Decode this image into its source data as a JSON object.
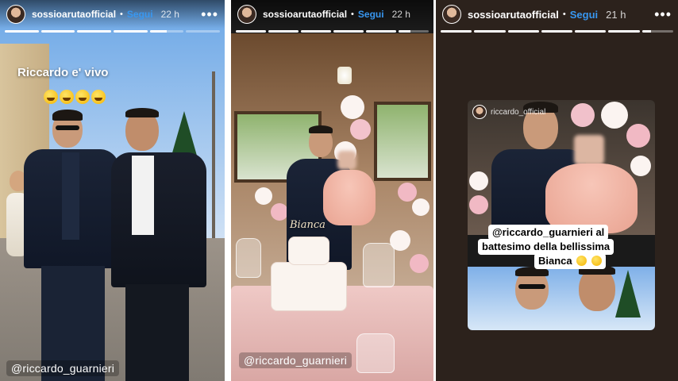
{
  "stories": [
    {
      "username": "sossioarutaofficial",
      "follow_label": "Segui",
      "time": "22 h",
      "more_label": "•••",
      "caption": "Riccardo e' vivo",
      "emoji_count": 4,
      "mention": "@riccardo_guarnieri"
    },
    {
      "username": "sossioarutaofficial",
      "follow_label": "Segui",
      "time": "22 h",
      "more_label": "•••",
      "mention": "@riccardo_guarnieri",
      "cake_text": "Bianca"
    },
    {
      "username": "sossioarutaofficial",
      "follow_label": "Segui",
      "time": "21 h",
      "more_label": "•••",
      "repost_user": "riccardo_official",
      "caption_line1": "@riccardo_guarnieri al",
      "caption_line2": "battesimo della bellissima",
      "caption_line3": "Bianca"
    }
  ],
  "colors": {
    "follow": "#3897f0",
    "caption_bg": "#ffffff"
  },
  "icons": [
    "avatar",
    "more-icon",
    "smiley-emoji"
  ]
}
